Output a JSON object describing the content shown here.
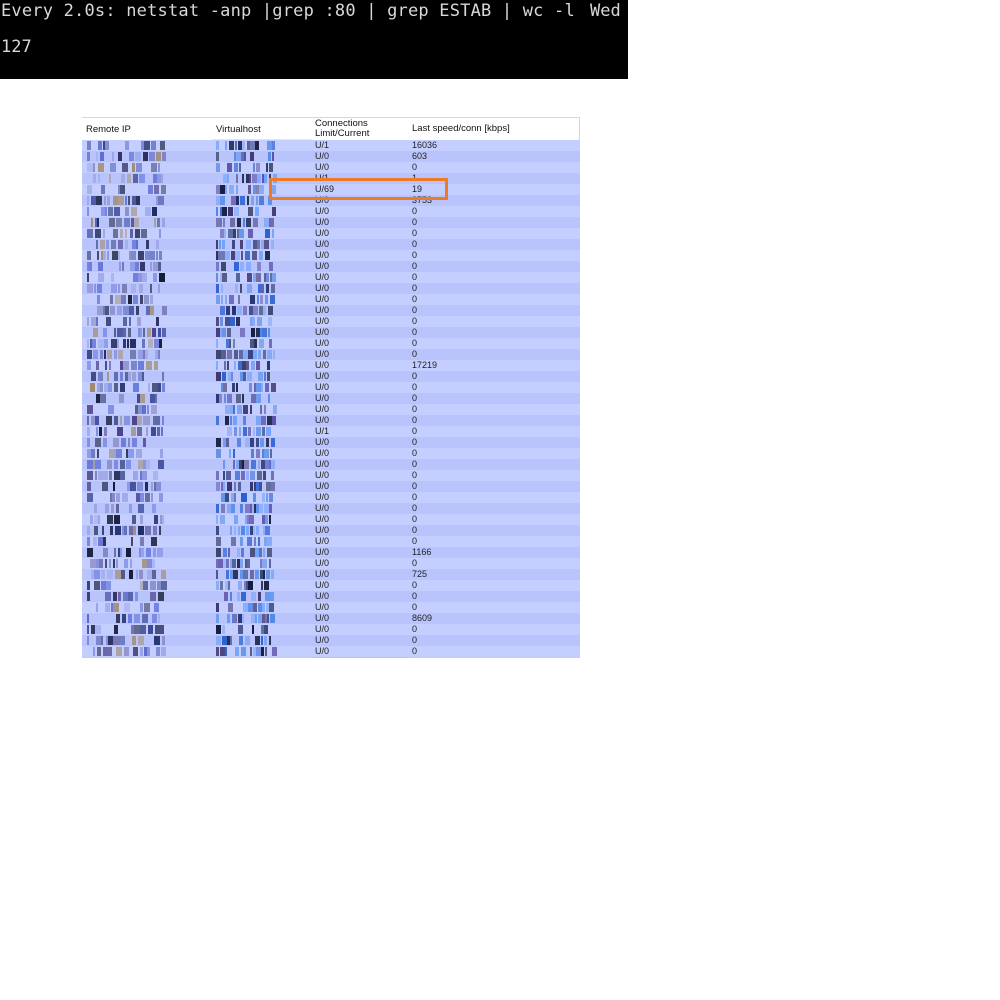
{
  "terminal": {
    "command": "Every 2.0s: netstat -anp |grep :80 | grep ESTAB | wc -l",
    "date": "Wed",
    "output": "127"
  },
  "table": {
    "headers": {
      "remote_ip": "Remote IP",
      "virtualhost": "Virtualhost",
      "connections_line1": "Connections",
      "connections_line2": "Limit/Current",
      "speed": "Last speed/conn [kbps]"
    },
    "rows": [
      {
        "conn": "U/1",
        "speed": "16036"
      },
      {
        "conn": "U/0",
        "speed": "603"
      },
      {
        "conn": "U/0",
        "speed": "0"
      },
      {
        "conn": "U/1",
        "speed": "1"
      },
      {
        "conn": "U/69",
        "speed": "19"
      },
      {
        "conn": "U/0",
        "speed": "3753"
      },
      {
        "conn": "U/0",
        "speed": "0"
      },
      {
        "conn": "U/0",
        "speed": "0"
      },
      {
        "conn": "U/0",
        "speed": "0"
      },
      {
        "conn": "U/0",
        "speed": "0"
      },
      {
        "conn": "U/0",
        "speed": "0"
      },
      {
        "conn": "U/0",
        "speed": "0"
      },
      {
        "conn": "U/0",
        "speed": "0"
      },
      {
        "conn": "U/0",
        "speed": "0"
      },
      {
        "conn": "U/0",
        "speed": "0"
      },
      {
        "conn": "U/0",
        "speed": "0"
      },
      {
        "conn": "U/0",
        "speed": "0"
      },
      {
        "conn": "U/0",
        "speed": "0"
      },
      {
        "conn": "U/0",
        "speed": "0"
      },
      {
        "conn": "U/0",
        "speed": "0"
      },
      {
        "conn": "U/0",
        "speed": "17219"
      },
      {
        "conn": "U/0",
        "speed": "0"
      },
      {
        "conn": "U/0",
        "speed": "0"
      },
      {
        "conn": "U/0",
        "speed": "0"
      },
      {
        "conn": "U/0",
        "speed": "0"
      },
      {
        "conn": "U/0",
        "speed": "0"
      },
      {
        "conn": "U/1",
        "speed": "0"
      },
      {
        "conn": "U/0",
        "speed": "0"
      },
      {
        "conn": "U/0",
        "speed": "0"
      },
      {
        "conn": "U/0",
        "speed": "0"
      },
      {
        "conn": "U/0",
        "speed": "0"
      },
      {
        "conn": "U/0",
        "speed": "0"
      },
      {
        "conn": "U/0",
        "speed": "0"
      },
      {
        "conn": "U/0",
        "speed": "0"
      },
      {
        "conn": "U/0",
        "speed": "0"
      },
      {
        "conn": "U/0",
        "speed": "0"
      },
      {
        "conn": "U/0",
        "speed": "0"
      },
      {
        "conn": "U/0",
        "speed": "1166"
      },
      {
        "conn": "U/0",
        "speed": "0"
      },
      {
        "conn": "U/0",
        "speed": "725"
      },
      {
        "conn": "U/0",
        "speed": "0"
      },
      {
        "conn": "U/0",
        "speed": "0"
      },
      {
        "conn": "U/0",
        "speed": "0"
      },
      {
        "conn": "U/0",
        "speed": "8609"
      },
      {
        "conn": "U/0",
        "speed": "0"
      },
      {
        "conn": "U/0",
        "speed": "0"
      },
      {
        "conn": "U/0",
        "speed": "0"
      }
    ]
  },
  "highlight_row": 4,
  "colors": {
    "terminal_bg": "#000000",
    "terminal_text": "#d8d8d8",
    "table_row_light": "#c4ceff",
    "table_row_dark": "#b8c4fb",
    "highlight_border": "#f07a22"
  }
}
